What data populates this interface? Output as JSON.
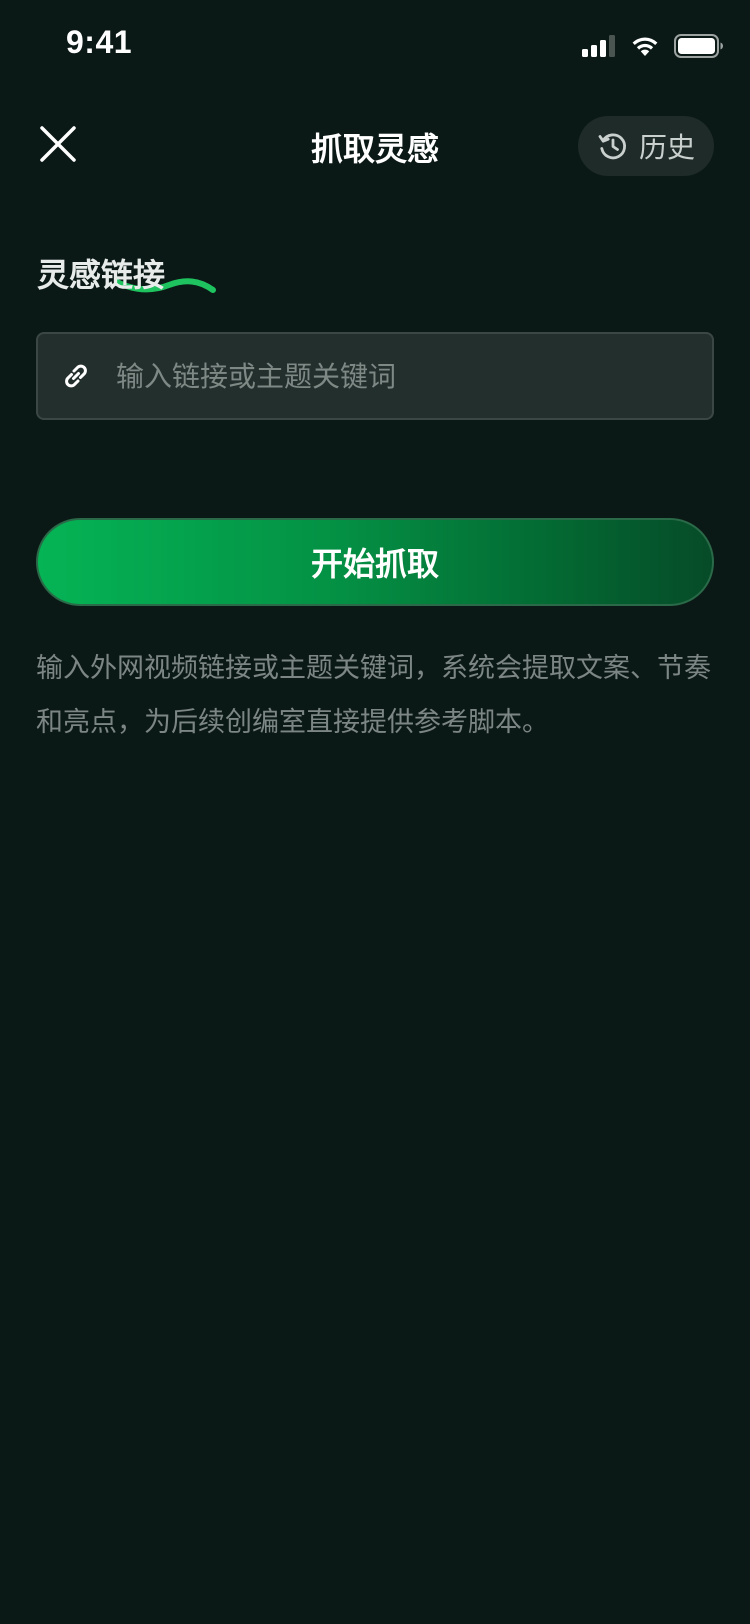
{
  "status_bar": {
    "time": "9:41"
  },
  "nav": {
    "title": "抓取灵感",
    "history_label": "历史"
  },
  "section": {
    "label": "灵感链接"
  },
  "input": {
    "placeholder": "输入链接或主题关键词",
    "value": ""
  },
  "actions": {
    "start_label": "开始抓取"
  },
  "description": "输入外网视频链接或主题关键词，系统会提取文案、节奏和亮点，为后续创编室直接提供参考脚本。",
  "colors": {
    "background": "#0b1916",
    "accent": "#05b455",
    "input_bg": "#232f2d",
    "muted_text": "#7c8684"
  },
  "icons": [
    "close-icon",
    "history-icon",
    "link-icon",
    "cellular-signal-icon",
    "wifi-icon",
    "battery-icon"
  ]
}
